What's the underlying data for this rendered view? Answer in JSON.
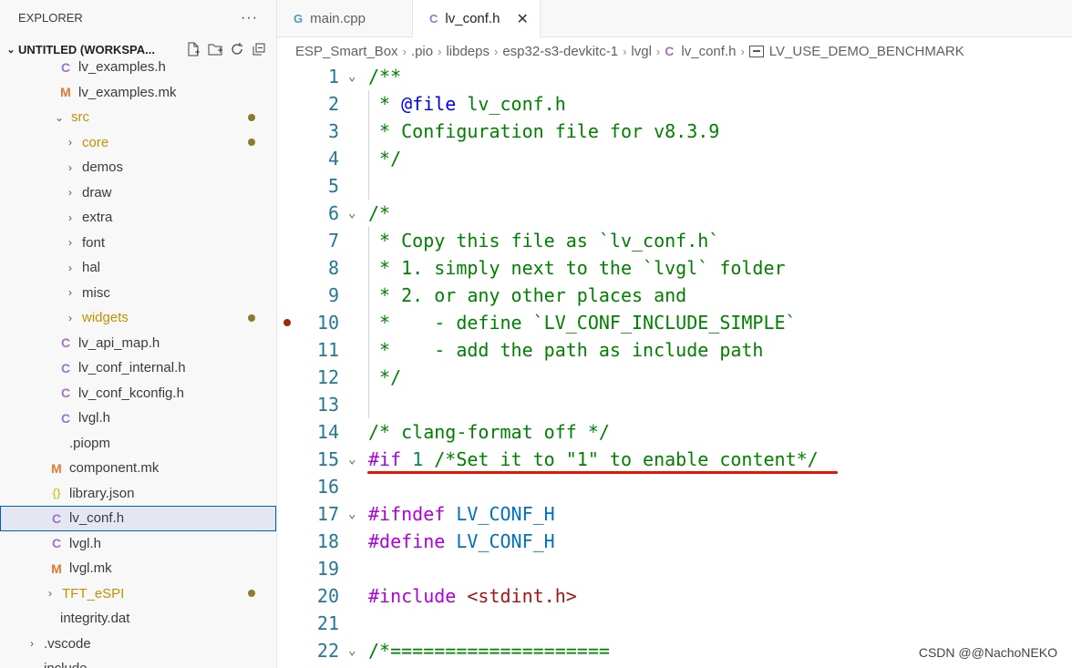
{
  "sidebar": {
    "title": "EXPLORER",
    "more": "···",
    "workspace": "UNTITLED (WORKSPA...",
    "items": [
      {
        "label": "lv_examples.h",
        "icon": "C",
        "kind": "c",
        "indent": 64
      },
      {
        "label": "lv_examples.mk",
        "icon": "M",
        "kind": "m",
        "indent": 64
      },
      {
        "label": "src",
        "chevron": "⌄",
        "indent": 58,
        "yellow": true,
        "dot": true
      },
      {
        "label": "core",
        "chevron": "›",
        "indent": 70,
        "yellow": true,
        "dot": true
      },
      {
        "label": "demos",
        "chevron": "›",
        "indent": 70
      },
      {
        "label": "draw",
        "chevron": "›",
        "indent": 70
      },
      {
        "label": "extra",
        "chevron": "›",
        "indent": 70
      },
      {
        "label": "font",
        "chevron": "›",
        "indent": 70
      },
      {
        "label": "hal",
        "chevron": "›",
        "indent": 70
      },
      {
        "label": "misc",
        "chevron": "›",
        "indent": 70
      },
      {
        "label": "widgets",
        "chevron": "›",
        "indent": 70,
        "yellow": true,
        "dot": true
      },
      {
        "label": "lv_api_map.h",
        "icon": "C",
        "kind": "c",
        "indent": 64
      },
      {
        "label": "lv_conf_internal.h",
        "icon": "C",
        "kind": "c",
        "indent": 64
      },
      {
        "label": "lv_conf_kconfig.h",
        "icon": "C",
        "kind": "c",
        "indent": 64
      },
      {
        "label": "lvgl.h",
        "icon": "C",
        "kind": "c",
        "indent": 64
      },
      {
        "label": ".piopm",
        "icon": "",
        "kind": "plain",
        "indent": 54
      },
      {
        "label": "component.mk",
        "icon": "M",
        "kind": "m",
        "indent": 54
      },
      {
        "label": "library.json",
        "icon": "{}",
        "kind": "j",
        "indent": 54
      },
      {
        "label": "lv_conf.h",
        "icon": "C",
        "kind": "c",
        "indent": 54,
        "selected": true
      },
      {
        "label": "lvgl.h",
        "icon": "C",
        "kind": "c",
        "indent": 54
      },
      {
        "label": "lvgl.mk",
        "icon": "M",
        "kind": "m",
        "indent": 54
      },
      {
        "label": "TFT_eSPI",
        "chevron": "›",
        "indent": 48,
        "yellow": true,
        "dot": true
      },
      {
        "label": "integrity.dat",
        "icon": "",
        "kind": "plain",
        "indent": 44
      },
      {
        "label": ".vscode",
        "chevron": "›",
        "indent": 28
      },
      {
        "label": "include",
        "chevron": "⌄",
        "indent": 28
      }
    ]
  },
  "tabs": [
    {
      "label": "main.cpp",
      "icon": "G",
      "kind": "cpp",
      "active": false
    },
    {
      "label": "lv_conf.h",
      "icon": "C",
      "kind": "c",
      "active": true,
      "close": "✕"
    }
  ],
  "breadcrumb": [
    "ESP_Smart_Box",
    ".pio",
    "libdeps",
    "esp32-s3-devkitc-1",
    "lvgl",
    "lv_conf.h",
    "LV_USE_DEMO_BENCHMARK"
  ],
  "editor": {
    "lines": [
      {
        "n": "1",
        "fold": true,
        "tokens": [
          [
            "c",
            "/**"
          ]
        ]
      },
      {
        "n": "2",
        "tokens": [
          [
            "c",
            " * "
          ],
          [
            "d",
            "@file"
          ],
          [
            "c",
            " lv_conf.h"
          ]
        ]
      },
      {
        "n": "3",
        "tokens": [
          [
            "c",
            " * Configuration file for v8.3.9"
          ]
        ]
      },
      {
        "n": "4",
        "tokens": [
          [
            "c",
            " */"
          ]
        ]
      },
      {
        "n": "5",
        "tokens": []
      },
      {
        "n": "6",
        "fold": true,
        "tokens": [
          [
            "c",
            "/*"
          ]
        ]
      },
      {
        "n": "7",
        "tokens": [
          [
            "c",
            " * Copy this file as `lv_conf.h`"
          ]
        ]
      },
      {
        "n": "8",
        "tokens": [
          [
            "c",
            " * 1. simply next to the `lvgl` folder"
          ]
        ]
      },
      {
        "n": "9",
        "tokens": [
          [
            "c",
            " * 2. or any other places and"
          ]
        ]
      },
      {
        "n": "10",
        "bp": true,
        "tokens": [
          [
            "c",
            " *    - define `LV_CONF_INCLUDE_SIMPLE`"
          ]
        ]
      },
      {
        "n": "11",
        "tokens": [
          [
            "c",
            " *    - add the path as include path"
          ]
        ]
      },
      {
        "n": "12",
        "tokens": [
          [
            "c",
            " */"
          ]
        ]
      },
      {
        "n": "13",
        "tokens": []
      },
      {
        "n": "14",
        "tokens": [
          [
            "c",
            "/* clang-format off */"
          ]
        ]
      },
      {
        "n": "15",
        "fold": true,
        "tokens": [
          [
            "p",
            "#if"
          ],
          [
            "t",
            " "
          ],
          [
            "num",
            "1"
          ],
          [
            "c",
            " /*Set it to \"1\" to enable content*/"
          ]
        ]
      },
      {
        "n": "16",
        "tokens": []
      },
      {
        "n": "17",
        "fold": true,
        "tokens": [
          [
            "p",
            "#ifndef"
          ],
          [
            "t",
            " "
          ],
          [
            "b",
            "LV_CONF_H"
          ]
        ]
      },
      {
        "n": "18",
        "tokens": [
          [
            "p",
            "#define"
          ],
          [
            "t",
            " "
          ],
          [
            "b",
            "LV_CONF_H"
          ]
        ]
      },
      {
        "n": "19",
        "tokens": []
      },
      {
        "n": "20",
        "tokens": [
          [
            "p",
            "#include"
          ],
          [
            "t",
            " "
          ],
          [
            "s",
            "<stdint.h>"
          ]
        ]
      },
      {
        "n": "21",
        "tokens": []
      },
      {
        "n": "22",
        "fold": true,
        "tokens": [
          [
            "c",
            "/*===================="
          ]
        ]
      }
    ]
  },
  "watermark": "CSDN @@NachoNEKO",
  "colors": {
    "accent": "#0060c0",
    "annotation": "#e51400"
  }
}
